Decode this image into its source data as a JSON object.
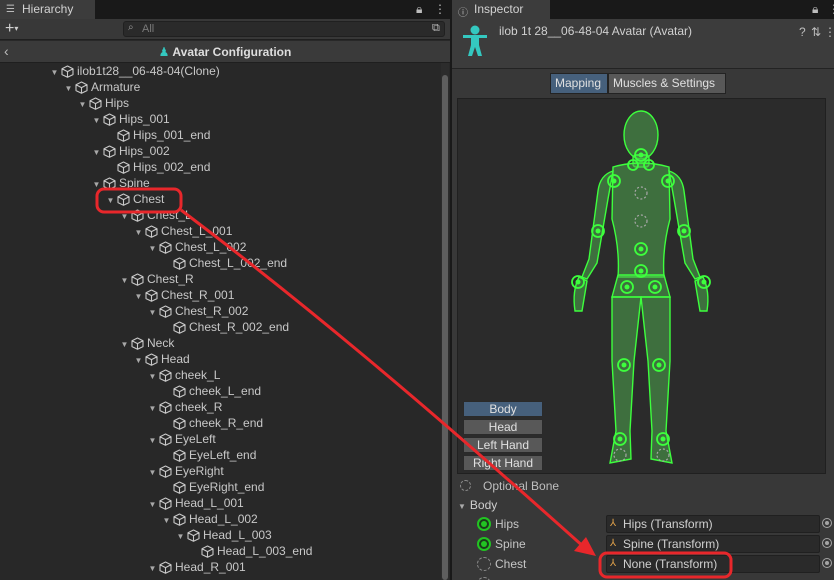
{
  "hierarchy": {
    "tab_title": "Hierarchy",
    "search_placeholder": "All",
    "header_title": "Avatar Configuration",
    "rows": [
      {
        "label": "ilob1t28__06-48-04(Clone)",
        "depth": 0,
        "expanded": true
      },
      {
        "label": "Armature",
        "depth": 1,
        "expanded": true
      },
      {
        "label": "Hips",
        "depth": 2,
        "expanded": true
      },
      {
        "label": "Hips_001",
        "depth": 3,
        "expanded": true
      },
      {
        "label": "Hips_001_end",
        "depth": 4,
        "expanded": false
      },
      {
        "label": "Hips_002",
        "depth": 3,
        "expanded": true
      },
      {
        "label": "Hips_002_end",
        "depth": 4,
        "expanded": false
      },
      {
        "label": "Spine",
        "depth": 3,
        "expanded": true
      },
      {
        "label": "Chest",
        "depth": 4,
        "expanded": true,
        "highlight": true
      },
      {
        "label": "Chest_L",
        "depth": 5,
        "expanded": true
      },
      {
        "label": "Chest_L_001",
        "depth": 6,
        "expanded": true
      },
      {
        "label": "Chest_L_002",
        "depth": 7,
        "expanded": true
      },
      {
        "label": "Chest_L_002_end",
        "depth": 8,
        "expanded": false
      },
      {
        "label": "Chest_R",
        "depth": 5,
        "expanded": true
      },
      {
        "label": "Chest_R_001",
        "depth": 6,
        "expanded": true
      },
      {
        "label": "Chest_R_002",
        "depth": 7,
        "expanded": true
      },
      {
        "label": "Chest_R_002_end",
        "depth": 8,
        "expanded": false
      },
      {
        "label": "Neck",
        "depth": 5,
        "expanded": true
      },
      {
        "label": "Head",
        "depth": 6,
        "expanded": true
      },
      {
        "label": "cheek_L",
        "depth": 7,
        "expanded": true
      },
      {
        "label": "cheek_L_end",
        "depth": 8,
        "expanded": false
      },
      {
        "label": "cheek_R",
        "depth": 7,
        "expanded": true
      },
      {
        "label": "cheek_R_end",
        "depth": 8,
        "expanded": false
      },
      {
        "label": "EyeLeft",
        "depth": 7,
        "expanded": true
      },
      {
        "label": "EyeLeft_end",
        "depth": 8,
        "expanded": false
      },
      {
        "label": "EyeRight",
        "depth": 7,
        "expanded": true
      },
      {
        "label": "EyeRight_end",
        "depth": 8,
        "expanded": false
      },
      {
        "label": "Head_L_001",
        "depth": 7,
        "expanded": true
      },
      {
        "label": "Head_L_002",
        "depth": 8,
        "expanded": true
      },
      {
        "label": "Head_L_003",
        "depth": 9,
        "expanded": true
      },
      {
        "label": "Head_L_003_end",
        "depth": 10,
        "expanded": false
      },
      {
        "label": "Head_R_001",
        "depth": 7,
        "expanded": true
      }
    ]
  },
  "inspector": {
    "tab_title": "Inspector",
    "object_name": "ilob 1t 28__06-48-04 Avatar (Avatar)",
    "tabs": [
      {
        "label": "Mapping",
        "active": true
      },
      {
        "label": "Muscles & Settings",
        "active": false
      }
    ],
    "body_parts": [
      {
        "label": "Body",
        "active": true
      },
      {
        "label": "Head",
        "active": false
      },
      {
        "label": "Left Hand",
        "active": false
      },
      {
        "label": "Right Hand",
        "active": false
      }
    ],
    "optional_bone_label": "Optional Bone",
    "section_label": "Body",
    "bones": [
      {
        "name": "Hips",
        "value": "Hips (Transform)",
        "assigned": true
      },
      {
        "name": "Spine",
        "value": "Spine (Transform)",
        "assigned": true
      },
      {
        "name": "Chest",
        "value": "None (Transform)",
        "assigned": false,
        "highlight": true
      }
    ]
  },
  "colors": {
    "bone_green": "#22c322",
    "annotation_red": "#e8272b",
    "accent_blue": "#46607c",
    "avatar_cyan": "#34c8c0"
  }
}
